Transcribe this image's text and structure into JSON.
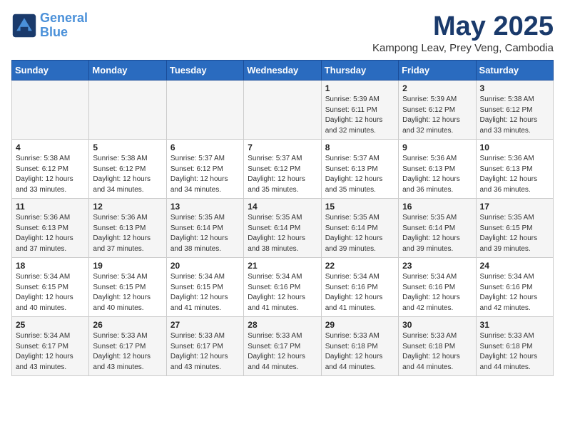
{
  "header": {
    "logo_line1": "General",
    "logo_line2": "Blue",
    "title": "May 2025",
    "subtitle": "Kampong Leav, Prey Veng, Cambodia"
  },
  "weekdays": [
    "Sunday",
    "Monday",
    "Tuesday",
    "Wednesday",
    "Thursday",
    "Friday",
    "Saturday"
  ],
  "weeks": [
    [
      {
        "day": "",
        "info": ""
      },
      {
        "day": "",
        "info": ""
      },
      {
        "day": "",
        "info": ""
      },
      {
        "day": "",
        "info": ""
      },
      {
        "day": "1",
        "info": "Sunrise: 5:39 AM\nSunset: 6:11 PM\nDaylight: 12 hours\nand 32 minutes."
      },
      {
        "day": "2",
        "info": "Sunrise: 5:39 AM\nSunset: 6:12 PM\nDaylight: 12 hours\nand 32 minutes."
      },
      {
        "day": "3",
        "info": "Sunrise: 5:38 AM\nSunset: 6:12 PM\nDaylight: 12 hours\nand 33 minutes."
      }
    ],
    [
      {
        "day": "4",
        "info": "Sunrise: 5:38 AM\nSunset: 6:12 PM\nDaylight: 12 hours\nand 33 minutes."
      },
      {
        "day": "5",
        "info": "Sunrise: 5:38 AM\nSunset: 6:12 PM\nDaylight: 12 hours\nand 34 minutes."
      },
      {
        "day": "6",
        "info": "Sunrise: 5:37 AM\nSunset: 6:12 PM\nDaylight: 12 hours\nand 34 minutes."
      },
      {
        "day": "7",
        "info": "Sunrise: 5:37 AM\nSunset: 6:12 PM\nDaylight: 12 hours\nand 35 minutes."
      },
      {
        "day": "8",
        "info": "Sunrise: 5:37 AM\nSunset: 6:13 PM\nDaylight: 12 hours\nand 35 minutes."
      },
      {
        "day": "9",
        "info": "Sunrise: 5:36 AM\nSunset: 6:13 PM\nDaylight: 12 hours\nand 36 minutes."
      },
      {
        "day": "10",
        "info": "Sunrise: 5:36 AM\nSunset: 6:13 PM\nDaylight: 12 hours\nand 36 minutes."
      }
    ],
    [
      {
        "day": "11",
        "info": "Sunrise: 5:36 AM\nSunset: 6:13 PM\nDaylight: 12 hours\nand 37 minutes."
      },
      {
        "day": "12",
        "info": "Sunrise: 5:36 AM\nSunset: 6:13 PM\nDaylight: 12 hours\nand 37 minutes."
      },
      {
        "day": "13",
        "info": "Sunrise: 5:35 AM\nSunset: 6:14 PM\nDaylight: 12 hours\nand 38 minutes."
      },
      {
        "day": "14",
        "info": "Sunrise: 5:35 AM\nSunset: 6:14 PM\nDaylight: 12 hours\nand 38 minutes."
      },
      {
        "day": "15",
        "info": "Sunrise: 5:35 AM\nSunset: 6:14 PM\nDaylight: 12 hours\nand 39 minutes."
      },
      {
        "day": "16",
        "info": "Sunrise: 5:35 AM\nSunset: 6:14 PM\nDaylight: 12 hours\nand 39 minutes."
      },
      {
        "day": "17",
        "info": "Sunrise: 5:35 AM\nSunset: 6:15 PM\nDaylight: 12 hours\nand 39 minutes."
      }
    ],
    [
      {
        "day": "18",
        "info": "Sunrise: 5:34 AM\nSunset: 6:15 PM\nDaylight: 12 hours\nand 40 minutes."
      },
      {
        "day": "19",
        "info": "Sunrise: 5:34 AM\nSunset: 6:15 PM\nDaylight: 12 hours\nand 40 minutes."
      },
      {
        "day": "20",
        "info": "Sunrise: 5:34 AM\nSunset: 6:15 PM\nDaylight: 12 hours\nand 41 minutes."
      },
      {
        "day": "21",
        "info": "Sunrise: 5:34 AM\nSunset: 6:16 PM\nDaylight: 12 hours\nand 41 minutes."
      },
      {
        "day": "22",
        "info": "Sunrise: 5:34 AM\nSunset: 6:16 PM\nDaylight: 12 hours\nand 41 minutes."
      },
      {
        "day": "23",
        "info": "Sunrise: 5:34 AM\nSunset: 6:16 PM\nDaylight: 12 hours\nand 42 minutes."
      },
      {
        "day": "24",
        "info": "Sunrise: 5:34 AM\nSunset: 6:16 PM\nDaylight: 12 hours\nand 42 minutes."
      }
    ],
    [
      {
        "day": "25",
        "info": "Sunrise: 5:34 AM\nSunset: 6:17 PM\nDaylight: 12 hours\nand 43 minutes."
      },
      {
        "day": "26",
        "info": "Sunrise: 5:33 AM\nSunset: 6:17 PM\nDaylight: 12 hours\nand 43 minutes."
      },
      {
        "day": "27",
        "info": "Sunrise: 5:33 AM\nSunset: 6:17 PM\nDaylight: 12 hours\nand 43 minutes."
      },
      {
        "day": "28",
        "info": "Sunrise: 5:33 AM\nSunset: 6:17 PM\nDaylight: 12 hours\nand 44 minutes."
      },
      {
        "day": "29",
        "info": "Sunrise: 5:33 AM\nSunset: 6:18 PM\nDaylight: 12 hours\nand 44 minutes."
      },
      {
        "day": "30",
        "info": "Sunrise: 5:33 AM\nSunset: 6:18 PM\nDaylight: 12 hours\nand 44 minutes."
      },
      {
        "day": "31",
        "info": "Sunrise: 5:33 AM\nSunset: 6:18 PM\nDaylight: 12 hours\nand 44 minutes."
      }
    ]
  ]
}
